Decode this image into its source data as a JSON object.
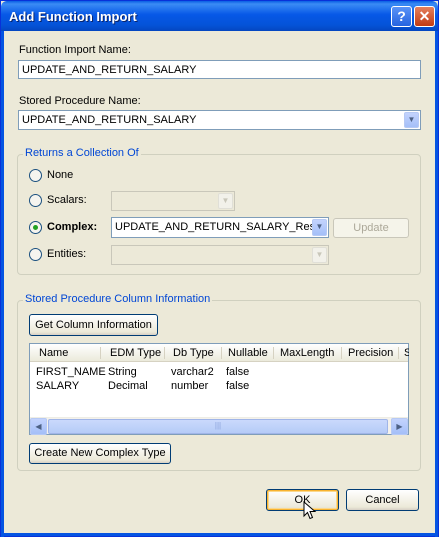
{
  "window": {
    "title": "Add Function Import",
    "help_glyph": "?",
    "close_glyph": "✕"
  },
  "function_import_name": {
    "label": "Function Import Name:",
    "value": "UPDATE_AND_RETURN_SALARY"
  },
  "stored_procedure": {
    "label": "Stored Procedure Name:",
    "value": "UPDATE_AND_RETURN_SALARY"
  },
  "returns_group": {
    "title": "Returns a Collection Of",
    "options": [
      {
        "label": "None",
        "checked": false
      },
      {
        "label": "Scalars:",
        "checked": false,
        "combo_value": ""
      },
      {
        "label": "Complex:",
        "checked": true,
        "combo_value": "UPDATE_AND_RETURN_SALARY_Result"
      },
      {
        "label": "Entities:",
        "checked": false,
        "combo_value": ""
      }
    ],
    "update_button": "Update"
  },
  "column_info_group": {
    "title": "Stored Procedure Column Information",
    "get_button": "Get Column Information",
    "columns": [
      "Name",
      "EDM Type",
      "Db Type",
      "Nullable",
      "MaxLength",
      "Precision",
      "S"
    ],
    "rows": [
      [
        "FIRST_NAME",
        "String",
        "varchar2",
        "false"
      ],
      [
        "SALARY",
        "Decimal",
        "number",
        "false"
      ]
    ],
    "create_button": "Create New Complex Type"
  },
  "footer": {
    "ok_button": "OK",
    "cancel_button": "Cancel"
  },
  "icons": {
    "dropdown": "chevron-down-icon",
    "scroll_left": "chevron-left-icon",
    "scroll_right": "chevron-right-icon",
    "cursor": "mouse-pointer-icon"
  },
  "colors": {
    "titlebar": "#0454e2",
    "dialog_bg": "#ece9d8",
    "group_title": "#0046d5",
    "radio_checked": "#21a121"
  }
}
